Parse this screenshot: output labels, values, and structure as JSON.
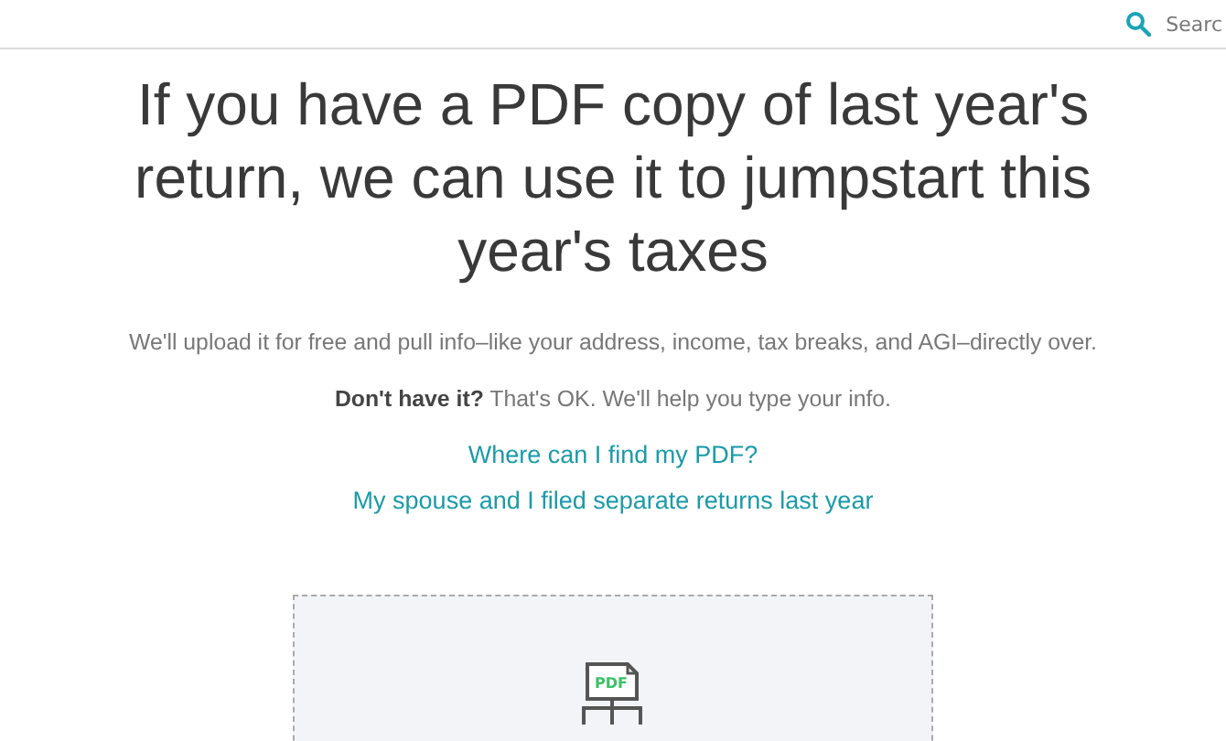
{
  "header": {
    "search_label": "Searc"
  },
  "title": "If you have a PDF copy of last year's return, we can use it to jumpstart this year's taxes",
  "description": "We'll upload it for free and pull info–like your address, income, tax breaks, and AGI–directly over.",
  "note": "**Don't have it?** That's OK. We'll help you type your info.",
  "links": [
    "Where can I find my PDF?",
    "My spouse and I filed separate returns last year"
  ],
  "upload_zone": {
    "icon_text": "PDF"
  }
}
